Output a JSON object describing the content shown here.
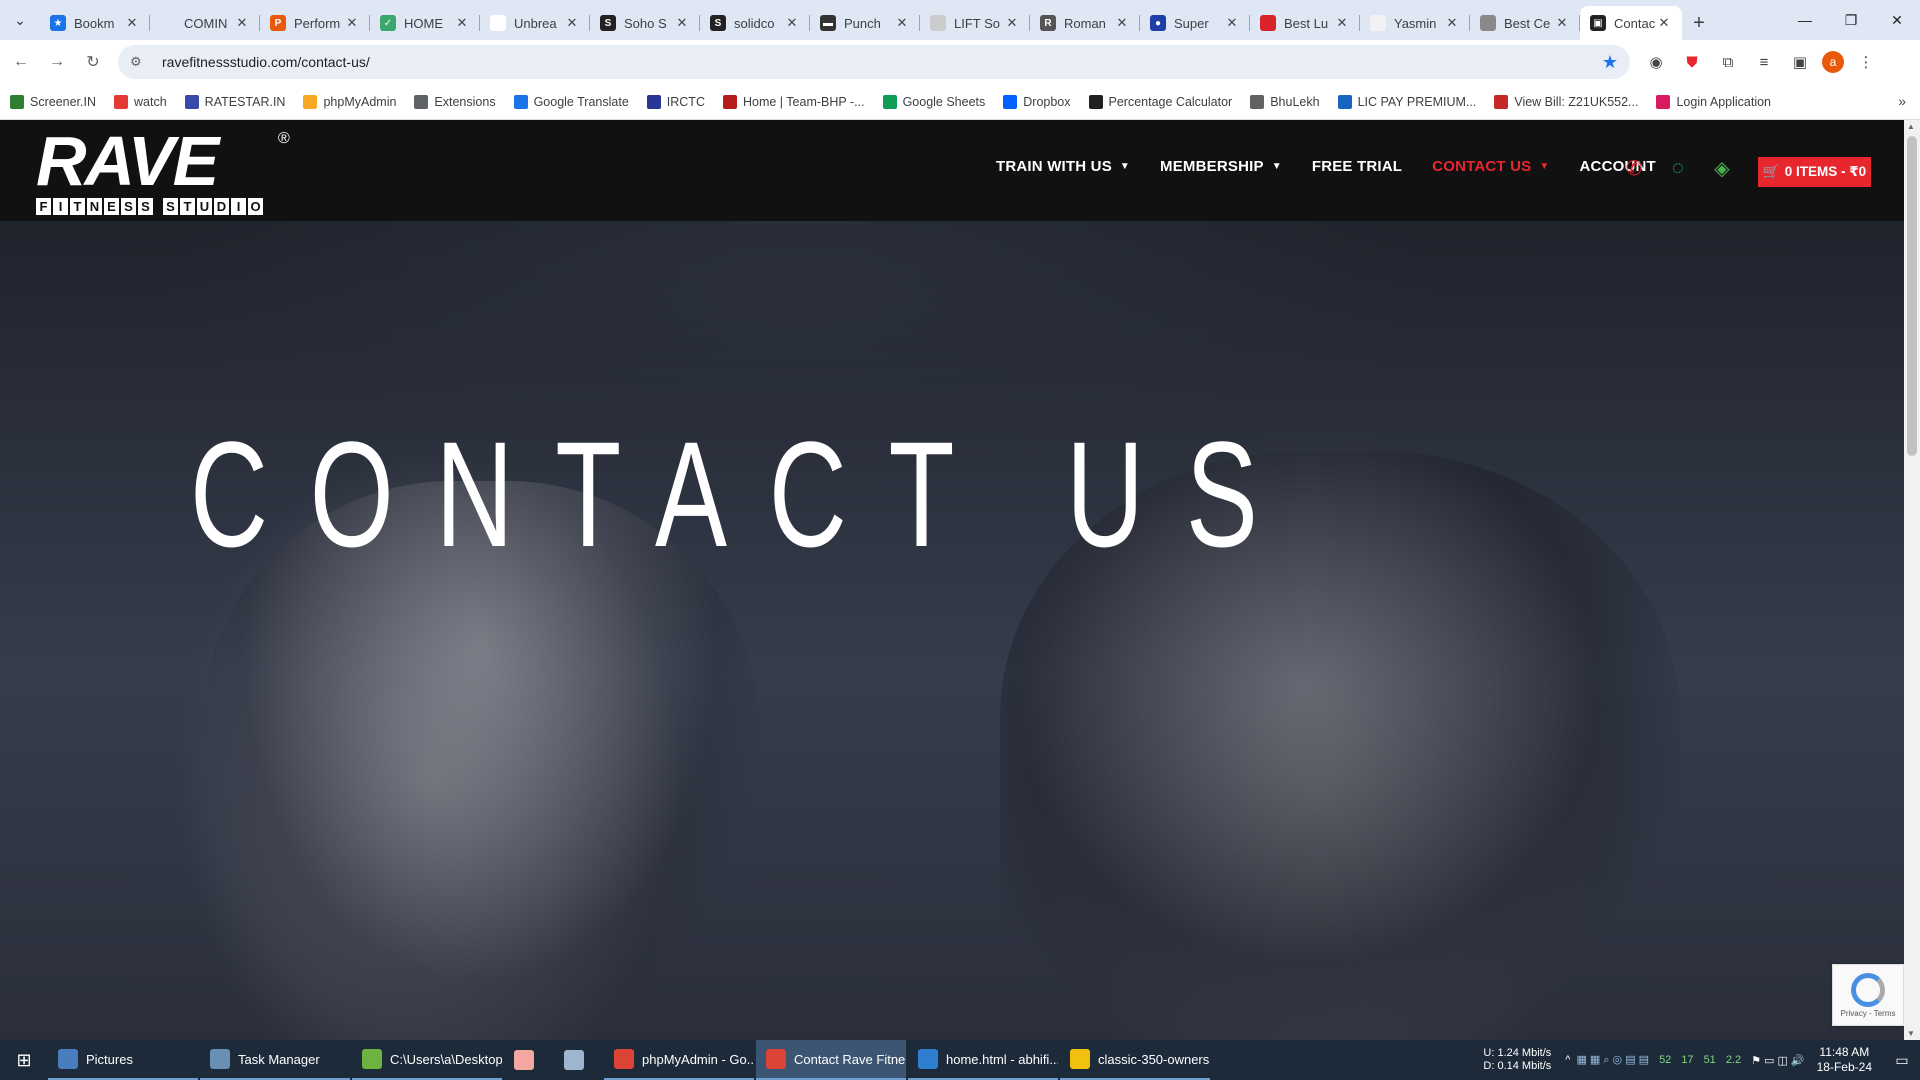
{
  "tabs": [
    {
      "title": "Bookm",
      "fav_color": "#1a73e8",
      "fav_glyph": "★"
    },
    {
      "title": "COMIN",
      "fav_color": "#dfe7f4",
      "fav_glyph": ""
    },
    {
      "title": "Perform",
      "fav_color": "#e8590c",
      "fav_glyph": "P"
    },
    {
      "title": "HOME",
      "fav_color": "#3aa76d",
      "fav_glyph": "✓"
    },
    {
      "title": "Unbrea",
      "fav_color": "#ffffff",
      "fav_glyph": ""
    },
    {
      "title": "Soho S",
      "fav_color": "#222222",
      "fav_glyph": "S"
    },
    {
      "title": "solidco",
      "fav_color": "#222222",
      "fav_glyph": "S"
    },
    {
      "title": "Punch",
      "fav_color": "#333333",
      "fav_glyph": "▬"
    },
    {
      "title": "LIFT So",
      "fav_color": "#cccccc",
      "fav_glyph": ""
    },
    {
      "title": "Roman",
      "fav_color": "#555555",
      "fav_glyph": "R"
    },
    {
      "title": "Super",
      "fav_color": "#1f3fa8",
      "fav_glyph": "●"
    },
    {
      "title": "Best Lu",
      "fav_color": "#d8232a",
      "fav_glyph": ""
    },
    {
      "title": "Yasmin",
      "fav_color": "#f2f2f2",
      "fav_glyph": ""
    },
    {
      "title": "Best Ce",
      "fav_color": "#8a8a8a",
      "fav_glyph": ""
    },
    {
      "title": "Contac",
      "fav_color": "#222222",
      "fav_glyph": "▣"
    }
  ],
  "address": {
    "url": "ravefitnessstudio.com/contact-us/"
  },
  "bookmarks": [
    {
      "label": "Screener.IN",
      "color": "#2e7d32"
    },
    {
      "label": "watch",
      "color": "#e53935"
    },
    {
      "label": "RATESTAR.IN",
      "color": "#3949ab"
    },
    {
      "label": "phpMyAdmin",
      "color": "#f9a825"
    },
    {
      "label": "Extensions",
      "color": "#5f6368"
    },
    {
      "label": "Google Translate",
      "color": "#1a73e8"
    },
    {
      "label": "IRCTC",
      "color": "#283593"
    },
    {
      "label": "Home | Team-BHP -...",
      "color": "#b71c1c"
    },
    {
      "label": "Google Sheets",
      "color": "#0f9d58"
    },
    {
      "label": "Dropbox",
      "color": "#0061ff"
    },
    {
      "label": "Percentage Calculator",
      "color": "#212121"
    },
    {
      "label": "BhuLekh",
      "color": "#616161"
    },
    {
      "label": "LIC PAY PREMIUM...",
      "color": "#1565c0"
    },
    {
      "label": "View Bill: Z21UK552...",
      "color": "#c62828"
    },
    {
      "label": "Login Application",
      "color": "#d81b60"
    }
  ],
  "site": {
    "logo_main": "RAVE",
    "logo_reg": "®",
    "logo_sub": [
      "F",
      "I",
      "T",
      "N",
      "E",
      "S",
      "S",
      " ",
      "S",
      "T",
      "U",
      "D",
      "I",
      "O"
    ],
    "nav": [
      {
        "label": "TRAIN WITH US",
        "caret": true,
        "active": false
      },
      {
        "label": "MEMBERSHIP",
        "caret": true,
        "active": false
      },
      {
        "label": "FREE TRIAL",
        "caret": false,
        "active": false
      },
      {
        "label": "CONTACT US",
        "caret": true,
        "active": true
      },
      {
        "label": "ACCOUNT",
        "caret": false,
        "active": false
      }
    ],
    "cart_label": "0 ITEMS - ₹0",
    "hero_title": "CONTACT US",
    "accent": "#e8262d"
  },
  "recaptcha": {
    "label": "Privacy - Terms"
  },
  "taskbar": {
    "items": [
      {
        "label": "Pictures",
        "color": "#4a7dbd",
        "active": false
      },
      {
        "label": "Task Manager",
        "color": "#6a8fb5",
        "active": false
      },
      {
        "label": "C:\\Users\\a\\Desktop...",
        "color": "#6cb33f",
        "active": false
      },
      {
        "label": "",
        "color": "#f4a7a0",
        "active": false
      },
      {
        "label": "",
        "color": "#9fb6d1",
        "active": false
      },
      {
        "label": "phpMyAdmin - Go...",
        "color": "#db4437",
        "active": false
      },
      {
        "label": "Contact Rave Fitne...",
        "color": "#db4437",
        "active": true
      },
      {
        "label": "home.html - abhifi...",
        "color": "#2f7fd1",
        "active": false
      },
      {
        "label": "classic-350-owners...",
        "color": "#f2c10f",
        "active": false
      }
    ],
    "net_up": "U:",
    "net_up_val": "1.24 Mbit/s",
    "net_down": "D:",
    "net_down_val": "0.14 Mbit/s",
    "tray_nums": [
      "52",
      "17",
      "51",
      "2.2"
    ],
    "time": "11:48 AM",
    "date": "18-Feb-24"
  }
}
